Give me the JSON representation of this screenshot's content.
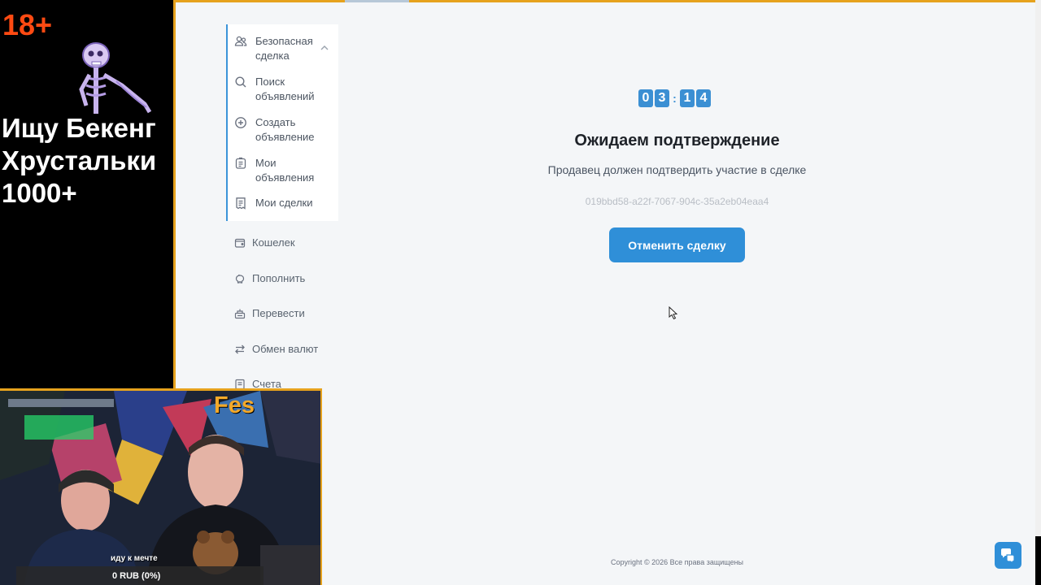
{
  "overlay": {
    "age_label": "18+",
    "lines": [
      "Ищу Бекенг",
      "Хрустальки",
      "1000+"
    ],
    "streamer_name": "Fes",
    "caption": "иду к мечте",
    "goal_amount": "0 RUB (0%)"
  },
  "sidebar": {
    "group": {
      "label": "Безопасная сделка",
      "label_lines": [
        "Безопасная",
        "сделка"
      ],
      "icon": "users-icon",
      "items": [
        {
          "label_lines": [
            "Поиск",
            "объявлений"
          ],
          "icon": "search-icon"
        },
        {
          "label_lines": [
            "Создать",
            "объявление"
          ],
          "icon": "plus-circle-icon"
        },
        {
          "label_lines": [
            "Мои",
            "объявления"
          ],
          "icon": "clipboard-icon"
        },
        {
          "label_lines": [
            "Мои сделки"
          ],
          "icon": "receipt-icon"
        }
      ]
    },
    "items": [
      {
        "label": "Кошелек",
        "icon": "wallet-icon"
      },
      {
        "label": "Пополнить",
        "icon": "piggy-bank-icon"
      },
      {
        "label": "Перевести",
        "icon": "transfer-icon"
      },
      {
        "label": "Обмен валют",
        "icon": "exchange-icon"
      },
      {
        "label": "Счета",
        "icon": "document-icon"
      }
    ]
  },
  "timer": {
    "digits": [
      "0",
      "3",
      "1",
      "4"
    ],
    "separator": ":"
  },
  "main": {
    "title": "Ожидаем подтверждение",
    "subtitle": "Продавец должен подтвердить участие в сделке",
    "deal_id": "019bbd58-a22f-7067-904c-35a2eb04eaa4",
    "cancel_label": "Отменить сделку"
  },
  "footer": {
    "copyright": "Copyright © 2026 Все права защищены"
  },
  "colors": {
    "accent": "#2f8fd8",
    "overlay_gold": "#e6a21d",
    "age_red": "#ff4a12"
  }
}
